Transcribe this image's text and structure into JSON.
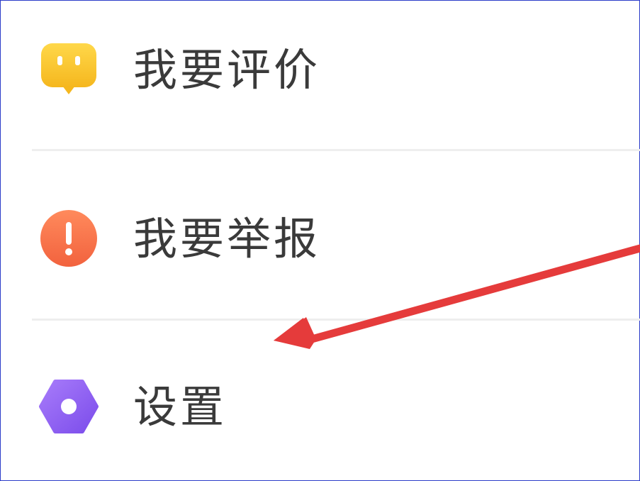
{
  "menu": {
    "items": [
      {
        "label": "我要评价",
        "icon": "comment-bubble-icon",
        "color": "#F6C22E"
      },
      {
        "label": "我要举报",
        "icon": "warning-icon",
        "color": "#F5734A"
      },
      {
        "label": "设置",
        "icon": "settings-hexagon-icon",
        "color": "#8B5CF6"
      }
    ]
  },
  "annotation": {
    "arrow_color": "#E53B3B"
  }
}
